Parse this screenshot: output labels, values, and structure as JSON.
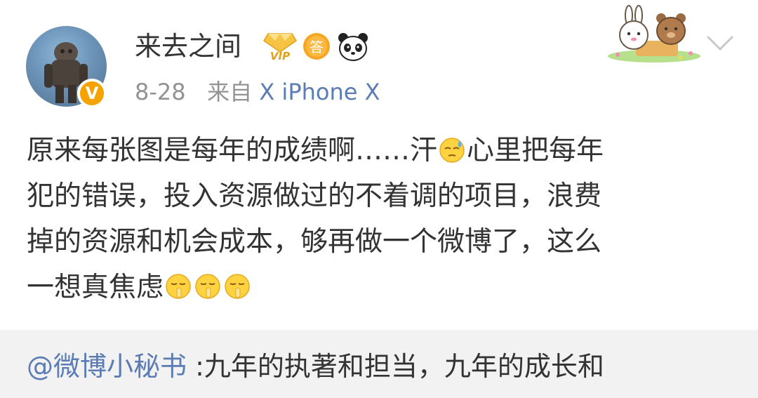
{
  "post": {
    "username": "来去之间",
    "verified_badge": "V",
    "badges": [
      "vip-icon",
      "answer-badge-icon",
      "panda-icon"
    ],
    "answer_badge_text": "答",
    "vip_text": "VIP",
    "time": "8-28",
    "from_label": "来自",
    "source": "X iPhone X",
    "content_lines": [
      "原来每张图是每年的成绩啊……汗",
      "心里把每年",
      "犯的错误，投入资源做过的不着调的项目，浪费",
      "掉的资源和机会成本，够再做一个微博了，这么",
      "一想真焦虑"
    ]
  },
  "repost": {
    "mention": "@微博小秘书",
    "text": ":九年的执著和担当，九年的成长和"
  },
  "colors": {
    "link": "#5b7cb4",
    "meta": "#939393",
    "badge": "#f5a300",
    "repost_bg": "#f2f2f2"
  }
}
